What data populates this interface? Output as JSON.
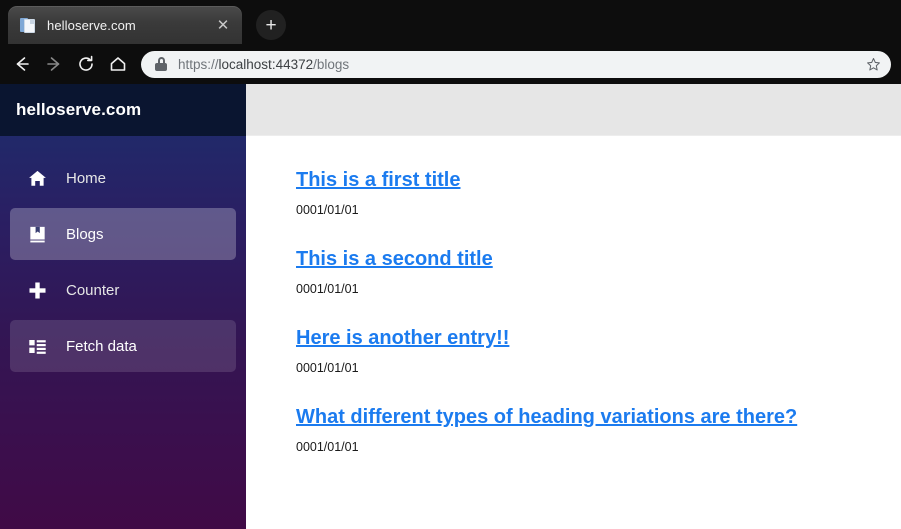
{
  "browser": {
    "tab": {
      "title": "helloserve.com",
      "favicon_icon": "document-icon",
      "close_icon": "✕"
    },
    "new_tab_label": "+",
    "nav": {
      "back_icon": "arrow-left-icon",
      "forward_icon": "arrow-right-icon",
      "reload_icon": "reload-icon",
      "home_icon": "home-icon"
    },
    "omnibox": {
      "lock_icon": "lock-icon",
      "url_scheme": "https://",
      "url_host": "localhost:44372",
      "url_path": "/blogs",
      "full_url": "https://localhost:44372/blogs",
      "star_icon": "star-outline-icon"
    }
  },
  "sidebar": {
    "brand": "helloserve.com",
    "items": [
      {
        "label": "Home",
        "icon": "home-icon",
        "state": "normal"
      },
      {
        "label": "Blogs",
        "icon": "book-icon",
        "state": "active"
      },
      {
        "label": "Counter",
        "icon": "plus-icon",
        "state": "normal"
      },
      {
        "label": "Fetch data",
        "icon": "list-grid-icon",
        "state": "hovered"
      }
    ]
  },
  "main": {
    "topbar": {
      "content": ""
    },
    "blogs": [
      {
        "title": "This is a first title",
        "date": "0001/01/01"
      },
      {
        "title": "This is a second title",
        "date": "0001/01/01"
      },
      {
        "title": "Here is another entry!!",
        "date": "0001/01/01"
      },
      {
        "title": "What different types of heading variations are there?",
        "date": "0001/01/01"
      }
    ]
  },
  "colors": {
    "link": "#1b7bef",
    "sidebar_top": "#1b2f6e",
    "sidebar_bottom": "#400a46",
    "brand_bar": "#0a1530",
    "topbar": "#e6e6e6",
    "chrome": "#0d0d0d"
  }
}
